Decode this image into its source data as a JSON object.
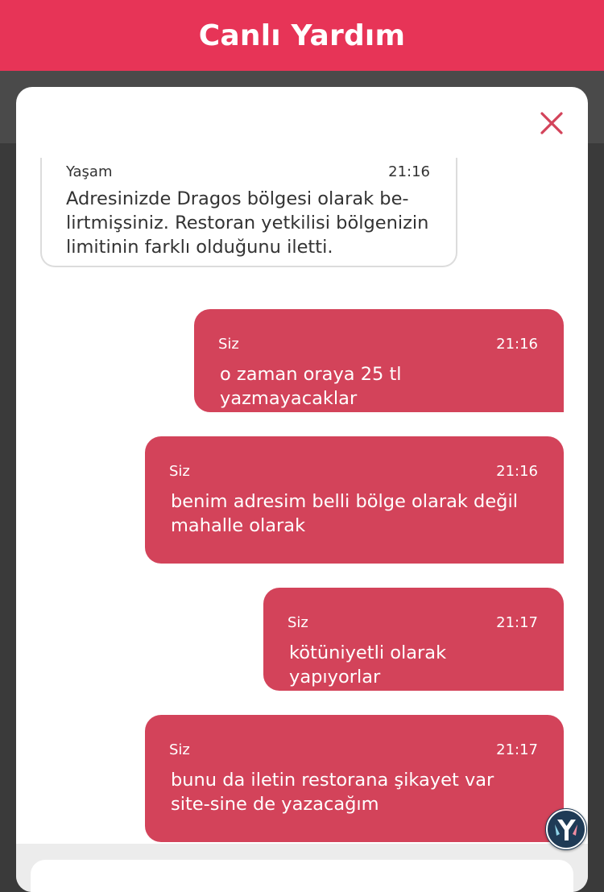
{
  "header": {
    "title": "Canlı Yardım"
  },
  "messages": [
    {
      "sender": "Yaşam",
      "time": "21:16",
      "text": "Adresinizde Dragos bölgesi olarak be-lirtmişsiniz. Restoran yetkilisi bölgenizin limitinin farklı olduğunu iletti."
    },
    {
      "sender": "Siz",
      "time": "21:16",
      "text": "o zaman oraya 25 tl yazmayacaklar"
    },
    {
      "sender": "Siz",
      "time": "21:16",
      "text": "benim adresim belli bölge olarak değil mahalle olarak"
    },
    {
      "sender": "Siz",
      "time": "21:17",
      "text": "kötüniyetli olarak yapıyorlar"
    },
    {
      "sender": "Siz",
      "time": "21:17",
      "text": "bunu da iletin restorana şikayet var site-sine de yazacağım"
    }
  ],
  "colors": {
    "brand": "#e73457",
    "bubble_out": "#d3435a"
  },
  "icons": {
    "close": "close-icon",
    "assistant": "assistant-logo-icon"
  }
}
